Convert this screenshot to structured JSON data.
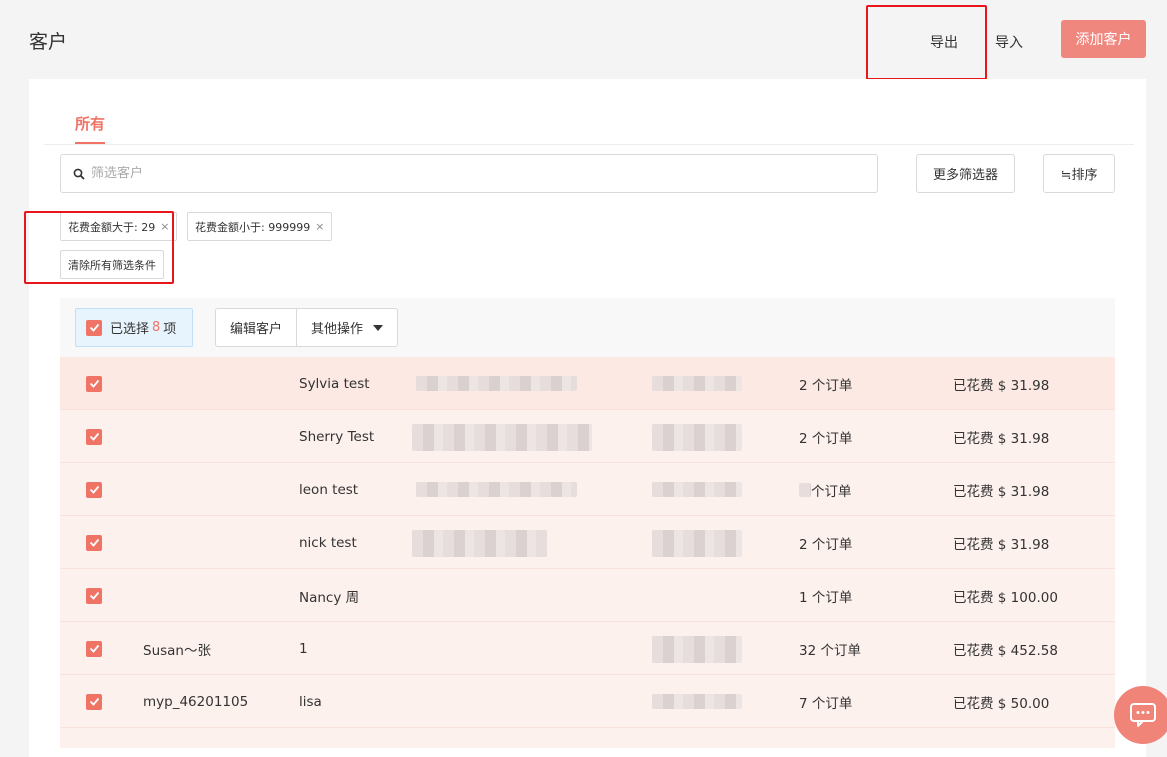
{
  "header": {
    "title": "客户",
    "export_label": "导出",
    "import_label": "导入",
    "add_label": "添加客户"
  },
  "tabs": [
    {
      "label": "所有"
    }
  ],
  "search": {
    "placeholder": "筛选客户"
  },
  "toolbar": {
    "more_filters_label": "更多筛选器",
    "sort_label": "≒排序"
  },
  "filters": {
    "chips": [
      {
        "label": "花费金额大于: 29"
      },
      {
        "label": "花费金额小于: 999999"
      }
    ],
    "clear_label": "清除所有筛选条件",
    "remove_glyph": "×"
  },
  "bulk": {
    "selected_prefix": "已选择",
    "selected_count": "8",
    "selected_suffix": "项",
    "edit_label": "编辑客户",
    "other_label": "其他操作"
  },
  "customers": [
    {
      "nickname": "",
      "name": "Sylvia test",
      "orders": "2 个订单",
      "spent": "已花费 $ 31.98"
    },
    {
      "nickname": "",
      "name": "Sherry Test",
      "orders": "2 个订单",
      "spent": "已花费 $ 31.98"
    },
    {
      "nickname": "",
      "name": "leon test",
      "orders": "个订单",
      "spent": "已花费 $ 31.98"
    },
    {
      "nickname": "",
      "name": "nick test",
      "orders": "2 个订单",
      "spent": "已花费 $ 31.98"
    },
    {
      "nickname": "",
      "name": "Nancy 周",
      "orders": "1 个订单",
      "spent": "已花费 $ 100.00"
    },
    {
      "nickname": "Susan～张",
      "name": "1",
      "orders": "32 个订单",
      "spent": "已花费 $ 452.58"
    },
    {
      "nickname": "myp_46201105",
      "name": "lisa",
      "orders": "7 个订单",
      "spent": "已花费 $ 50.00"
    }
  ],
  "colors": {
    "accent": "#ef7466",
    "add_button": "#f0877f",
    "row_bg": "#fdf1ee",
    "highlight": "#e8161b"
  },
  "icons": {
    "search": "search-icon",
    "check": "check-icon",
    "chat": "chat-icon"
  }
}
